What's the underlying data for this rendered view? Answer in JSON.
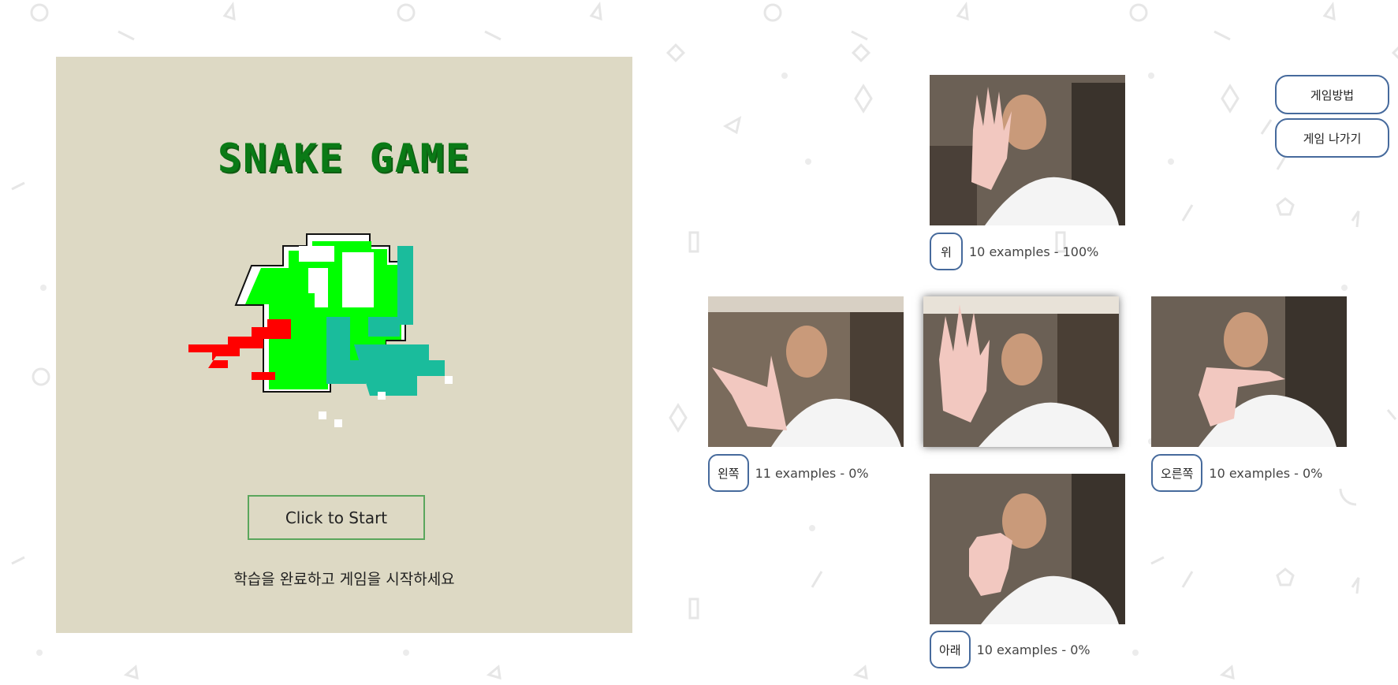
{
  "game": {
    "title": "SNAKE GAME",
    "start_label": "Click to Start",
    "hint": "학습을 완료하고 게임을 시작하세요"
  },
  "classes": {
    "up": {
      "label": "위",
      "info": "10 examples - 100%"
    },
    "left": {
      "label": "왼쪽",
      "info": "11 examples - 0%"
    },
    "right": {
      "label": "오른쪽",
      "info": "10 examples - 0%"
    },
    "down": {
      "label": "아래",
      "info": "10 examples - 0%"
    }
  },
  "controls": {
    "game_rules_label": "게임방법",
    "exit_label": "게임 나가기"
  },
  "colors": {
    "panel_bg": "#ddd9c4",
    "title_green": "#0a7a16",
    "snake_green": "#00ff00",
    "snake_teal": "#1abc9c",
    "tongue_red": "#ff0000",
    "button_border": "#466a9c"
  }
}
